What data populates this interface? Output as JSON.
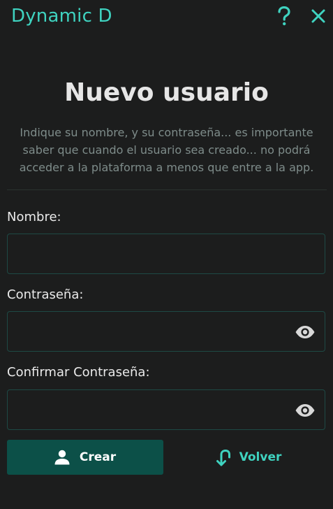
{
  "window": {
    "title": "Dynamic D",
    "help_icon": "question-mark-icon",
    "close_icon": "close-x-icon",
    "accent_color": "#3fd3c0"
  },
  "main": {
    "heading": "Nuevo usuario",
    "description": "Indique su nombre, y su contraseña... es importante saber que cuando el usuario sea creado... no podrá acceder a la plataforma a menos que entre a la app."
  },
  "form": {
    "name": {
      "label": "Nombre:",
      "value": "",
      "placeholder": ""
    },
    "password": {
      "label": "Contraseña:",
      "value": "",
      "placeholder": "",
      "toggle_icon": "eye-icon"
    },
    "confirm_password": {
      "label": "Confirmar Contraseña:",
      "value": "",
      "placeholder": "",
      "toggle_icon": "eye-icon"
    }
  },
  "actions": {
    "create": {
      "label": "Crear",
      "icon": "user-icon",
      "color": "#0c5048"
    },
    "back": {
      "label": "Volver",
      "icon": "return-arrow-icon"
    }
  }
}
